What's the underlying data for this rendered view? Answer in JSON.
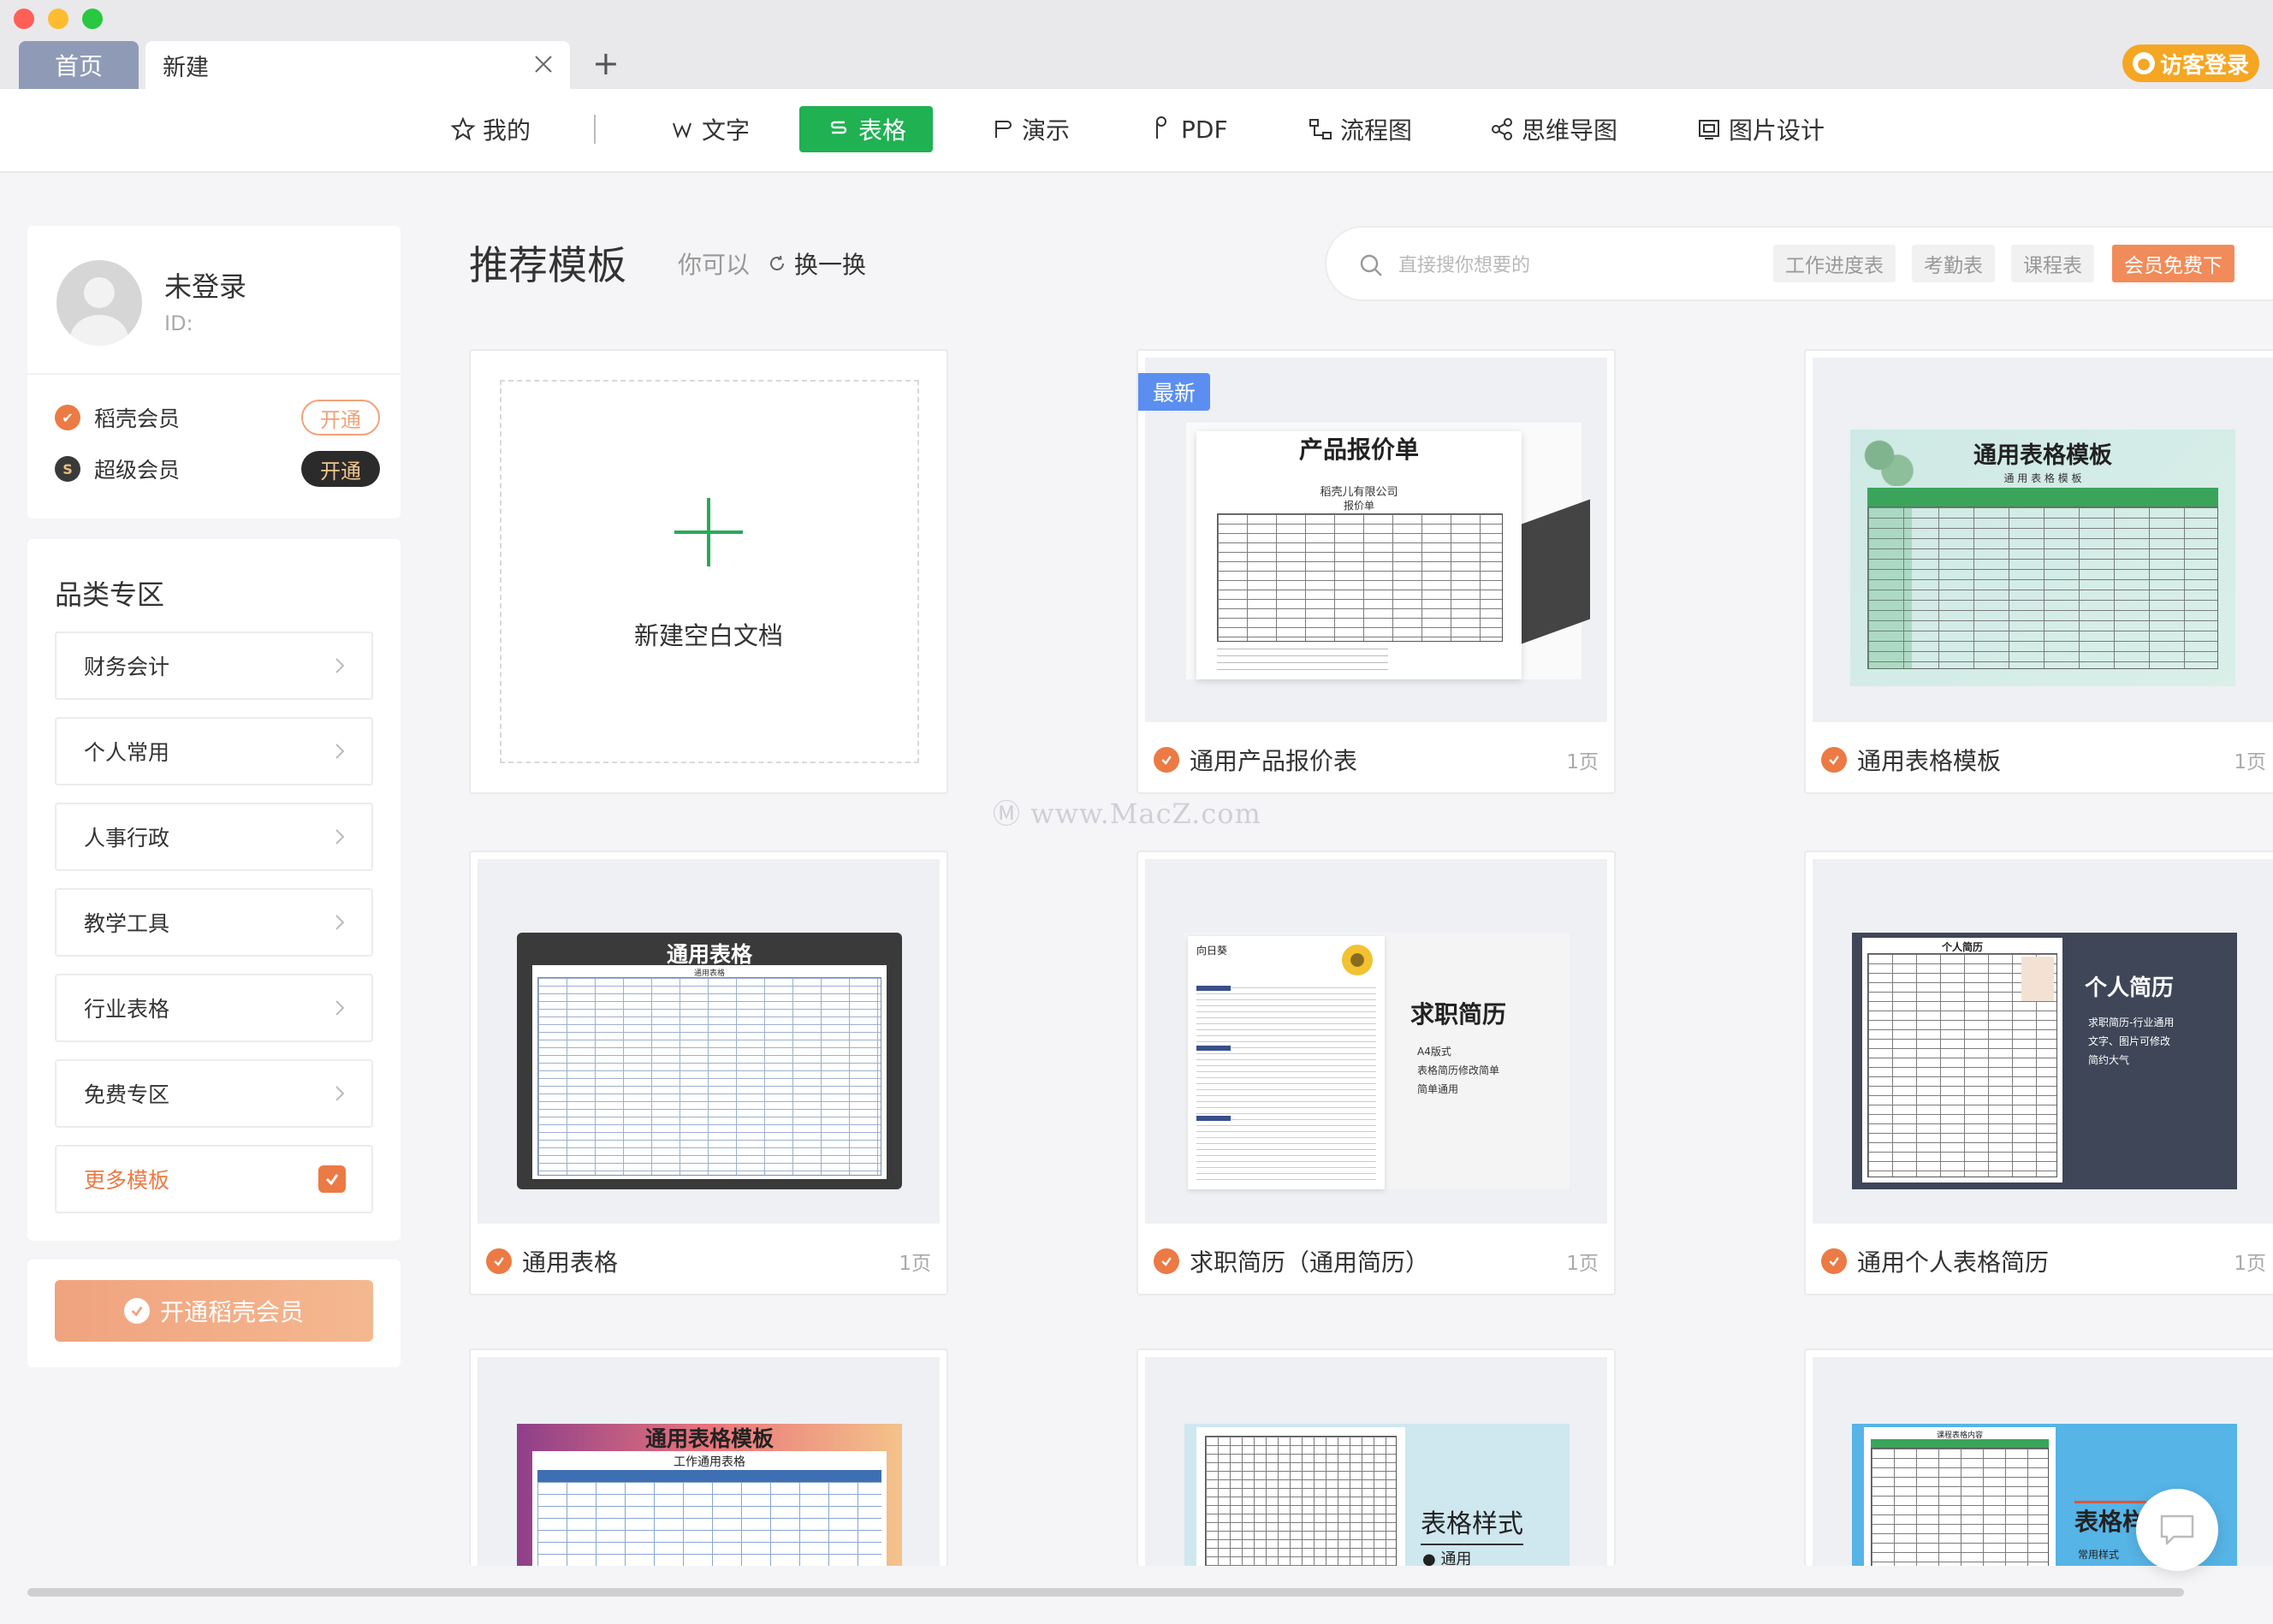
{
  "tabs": {
    "home": "首页",
    "current": "新建"
  },
  "guest_login": "访客登录",
  "nav": {
    "mine": "我的",
    "items": [
      "文字",
      "表格",
      "演示",
      "PDF",
      "流程图",
      "思维导图",
      "图片设计"
    ],
    "active": "表格"
  },
  "user": {
    "name": "未登录",
    "id_label": "ID:",
    "memberships": [
      {
        "label": "稻壳会员",
        "action": "开通"
      },
      {
        "label": "超级会员",
        "action": "开通"
      }
    ]
  },
  "categories": {
    "title": "品类专区",
    "items": [
      "财务会计",
      "个人常用",
      "人事行政",
      "教学工具",
      "行业表格",
      "免费专区"
    ],
    "more": "更多模板"
  },
  "vip_button": "开通稻壳会员",
  "main": {
    "title": "推荐模板",
    "you_can": "你可以",
    "refresh": "换一换"
  },
  "search": {
    "placeholder": "直接搜你想要的",
    "tags": [
      "工作进度表",
      "考勤表",
      "课程表"
    ],
    "vip_tag": "会员免费下"
  },
  "new_blank": "新建空白文档",
  "badge_new": "最新",
  "templates": [
    {
      "name": "通用产品报价表",
      "pages": "1页",
      "thumb_title": "产品报价单",
      "thumb_sub": "稻壳儿有限公司",
      "thumb_sub2": "报价单"
    },
    {
      "name": "通用表格模板",
      "pages": "1页",
      "thumb_title": "通用表格模板",
      "thumb_sub": "通 用 表 格 模 板"
    },
    {
      "name": "通用表格",
      "pages": "1页",
      "thumb_title": "通用表格",
      "thumb_sub": "通用表格"
    },
    {
      "name": "求职简历（通用简历）",
      "pages": "1页",
      "thumb_title": "求职简历",
      "thumb_name": "向日葵",
      "thumb_bullets": [
        "A4版式",
        "表格简历修改简单",
        "简单通用"
      ]
    },
    {
      "name": "通用个人表格简历",
      "pages": "1页",
      "thumb_title": "个人简历",
      "thumb_sub": "个人简历",
      "thumb_bullets": [
        "求职简历-行业通用",
        "文字、图片可修改",
        "简约大气"
      ]
    },
    {
      "thumb_title": "通用表格模板",
      "thumb_sub": "工作通用表格"
    },
    {
      "thumb_title": "表格样式",
      "thumb_sub": "通用"
    },
    {
      "thumb_title": "表格样",
      "thumb_sub": "课程表格内容",
      "thumb_bullet": "常用样式"
    }
  ],
  "watermark": "www.MacZ.com",
  "colors": {
    "accent_green": "#1fb152",
    "brand_orange": "#ec7a44",
    "guest_yellow": "#f5a623"
  }
}
